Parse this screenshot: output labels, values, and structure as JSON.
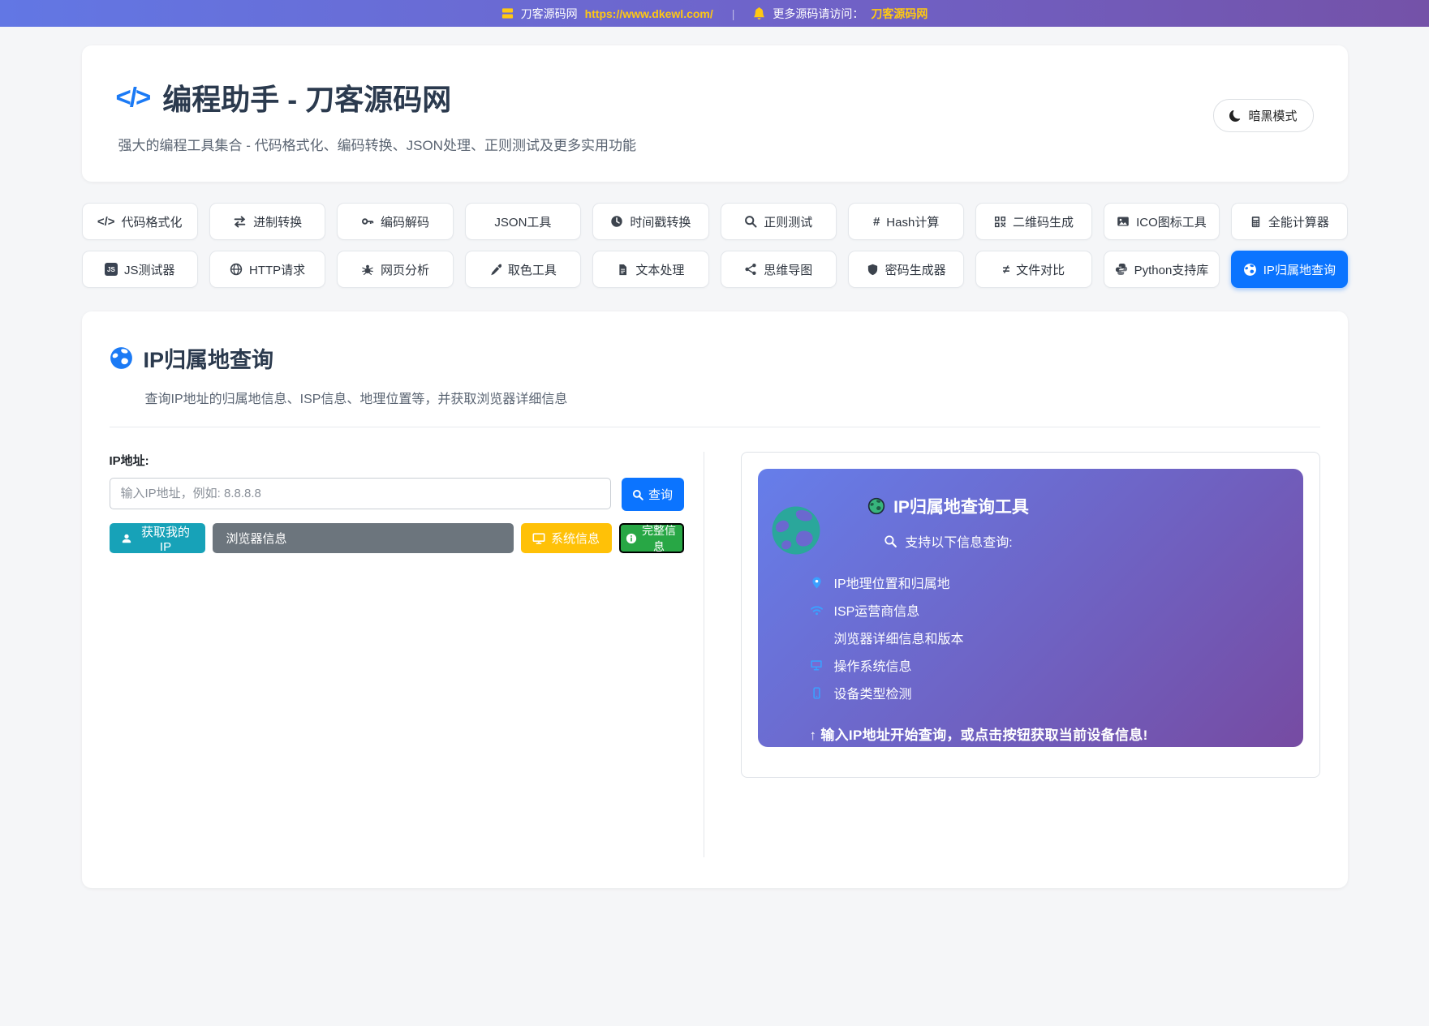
{
  "topbar": {
    "site_name": "刀客源码网",
    "site_url": "https://www.dkewl.com/",
    "divider": "|",
    "notice": "更多源码请访问：",
    "notice_link": "刀客源码网"
  },
  "header": {
    "code_glyph": "</>",
    "title": "编程助手 - 刀客源码网",
    "subtitle": "强大的编程工具集合 - 代码格式化、编码转换、JSON处理、正则测试及更多实用功能",
    "dark_mode_label": "暗黑模式"
  },
  "nav": {
    "row1": [
      {
        "icon": "code-icon",
        "label": "代码格式化"
      },
      {
        "icon": "swap-icon",
        "label": "进制转换"
      },
      {
        "icon": "key-icon",
        "label": "编码解码"
      },
      {
        "icon": "none",
        "label": "JSON工具"
      },
      {
        "icon": "clock-icon",
        "label": "时间戳转换"
      },
      {
        "icon": "search-icon",
        "label": "正则测试"
      },
      {
        "icon": "hash-icon",
        "label": "Hash计算"
      },
      {
        "icon": "qr-icon",
        "label": "二维码生成"
      },
      {
        "icon": "image-icon",
        "label": "ICO图标工具"
      },
      {
        "icon": "calculator-icon",
        "label": "全能计算器"
      }
    ],
    "row2": [
      {
        "icon": "js-icon",
        "label": "JS测试器"
      },
      {
        "icon": "globe-icon",
        "label": "HTTP请求"
      },
      {
        "icon": "spider-icon",
        "label": "网页分析"
      },
      {
        "icon": "eyedropper-icon",
        "label": "取色工具"
      },
      {
        "icon": "file-text-icon",
        "label": "文本处理"
      },
      {
        "icon": "mindmap-icon",
        "label": "思维导图"
      },
      {
        "icon": "shield-icon",
        "label": "密码生成器"
      },
      {
        "icon": "not-equal-icon",
        "label": "文件对比"
      },
      {
        "icon": "python-icon",
        "label": "Python支持库"
      },
      {
        "icon": "globe-icon",
        "label": "IP归属地查询",
        "active": true
      }
    ]
  },
  "tool": {
    "title": "IP归属地查询",
    "subtitle": "查询IP地址的归属地信息、ISP信息、地理位置等，并获取浏览器详细信息",
    "ip_label": "IP地址:",
    "input_placeholder": "输入IP地址，例如: 8.8.8.8",
    "input_value": "",
    "query_button": "查询",
    "my_ip_button": "获取我的IP",
    "browser_button": "浏览器信息",
    "system_button": "系统信息",
    "full_button": "完整信息"
  },
  "panel": {
    "title": "IP归属地查询工具",
    "subtitle": "支持以下信息查询:",
    "items": [
      {
        "icon": "pin-icon",
        "label": "IP地理位置和归属地"
      },
      {
        "icon": "wifi-icon",
        "label": "ISP运营商信息"
      },
      {
        "icon": "none",
        "label": "浏览器详细信息和版本"
      },
      {
        "icon": "monitor-icon",
        "label": "操作系统信息"
      },
      {
        "icon": "phone-icon",
        "label": "设备类型检测"
      }
    ],
    "footer": "↑ 输入IP地址开始查询，或点击按钮获取当前设备信息!"
  },
  "colors": {
    "accent_blue": "#0b74ff",
    "topbar_gradient_start": "#6277e4",
    "topbar_gradient_end": "#7452a8",
    "panel_gradient_start": "#667eea",
    "panel_gradient_end": "#764ba2",
    "yellow": "#ffc812",
    "teal_button": "#17a2b8",
    "gray_button": "#6c757d",
    "yellow_button": "#ffc107",
    "green_button": "#28a745"
  }
}
